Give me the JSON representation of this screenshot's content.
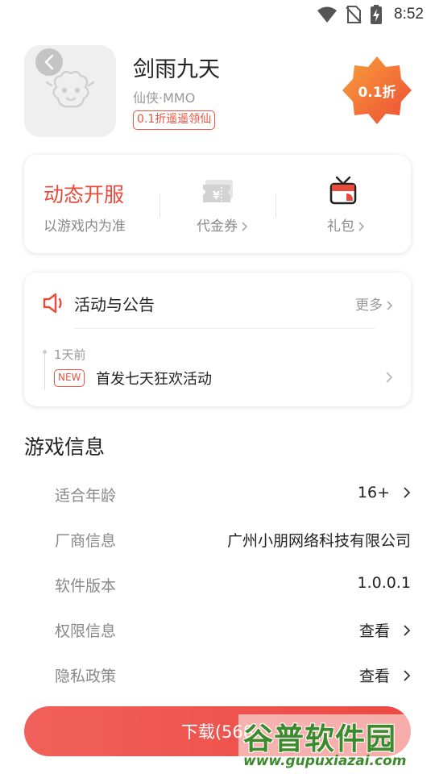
{
  "status_bar": {
    "time": "8:52"
  },
  "app": {
    "name": "剑雨九天",
    "genre": "仙侠·MMO",
    "promo_tag": "0.1折遥遥领仙",
    "discount_badge": "0.1折"
  },
  "features": {
    "open_server_title": "动态开服",
    "open_server_sub": "以游戏内为准",
    "voucher_label": "代金券",
    "gift_label": "礼包"
  },
  "activity": {
    "title": "活动与公告",
    "more_label": "更多",
    "item_time": "1天前",
    "item_badge": "NEW",
    "item_title": "首发七天狂欢活动"
  },
  "game_info": {
    "section_title": "游戏信息",
    "rows": [
      {
        "label": "适合年龄",
        "value": "16+"
      },
      {
        "label": "厂商信息",
        "value": "广州小朋网络科技有限公司"
      },
      {
        "label": "软件版本",
        "value": "1.0.0.1"
      },
      {
        "label": "权限信息",
        "value": "查看"
      },
      {
        "label": "隐私政策",
        "value": "查看"
      }
    ]
  },
  "download": {
    "label": "下载(568"
  },
  "watermark": {
    "brand": "谷普软件园",
    "url": "www.gupuxiazai.com"
  },
  "colors": {
    "accent": "#e84a3c",
    "download": "#ee5049",
    "badge": "#f26d3d",
    "watermark": "#3d8a2c"
  }
}
